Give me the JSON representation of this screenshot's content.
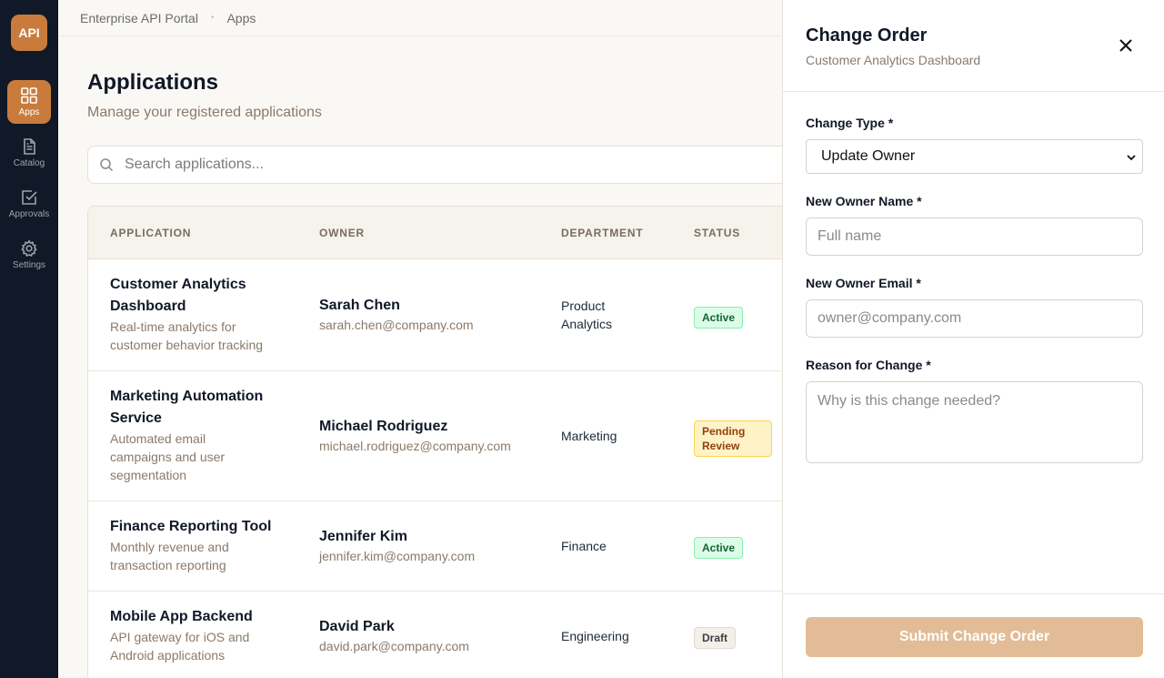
{
  "sidebar": {
    "logo": "API",
    "items": [
      {
        "label": "Apps",
        "icon": "grid-icon"
      },
      {
        "label": "Catalog",
        "icon": "document-icon"
      },
      {
        "label": "Approvals",
        "icon": "checkbox-icon"
      },
      {
        "label": "Settings",
        "icon": "gear-icon"
      }
    ]
  },
  "breadcrumb": {
    "root": "Enterprise API Portal",
    "sep": "•",
    "current": "Apps"
  },
  "page": {
    "title": "Applications",
    "subtitle": "Manage your registered applications"
  },
  "search": {
    "placeholder": "Search applications..."
  },
  "table": {
    "columns": [
      "APPLICATION",
      "OWNER",
      "DEPARTMENT",
      "STATUS"
    ],
    "rows": [
      {
        "name_l1": "Customer Analytics",
        "name_l2": "Dashboard",
        "desc_l1": "Real-time analytics for",
        "desc_l2": "customer behavior tracking",
        "desc_l3": "",
        "owner": "Sarah Chen",
        "email": "sarah.chen@company.com",
        "dept_l1": "Product",
        "dept_l2": "Analytics",
        "status_l1": "Active",
        "status_l2": ""
      },
      {
        "name_l1": "Marketing Automation",
        "name_l2": "Service",
        "desc_l1": "Automated email",
        "desc_l2": "campaigns and user",
        "desc_l3": "segmentation",
        "owner": "Michael Rodriguez",
        "email": "michael.rodriguez@company.com",
        "dept_l1": "Marketing",
        "dept_l2": "",
        "status_l1": "Pending",
        "status_l2": "Review"
      },
      {
        "name_l1": "Finance Reporting Tool",
        "name_l2": "",
        "desc_l1": "Monthly revenue and",
        "desc_l2": "transaction reporting",
        "desc_l3": "",
        "owner": "Jennifer Kim",
        "email": "jennifer.kim@company.com",
        "dept_l1": "Finance",
        "dept_l2": "",
        "status_l1": "Active",
        "status_l2": ""
      },
      {
        "name_l1": "Mobile App Backend",
        "name_l2": "",
        "desc_l1": "API gateway for iOS and",
        "desc_l2": "Android applications",
        "desc_l3": "",
        "owner": "David Park",
        "email": "david.park@company.com",
        "dept_l1": "Engineering",
        "dept_l2": "",
        "status_l1": "Draft",
        "status_l2": ""
      }
    ]
  },
  "drawer": {
    "title": "Change Order",
    "subtitle": "Customer Analytics Dashboard",
    "change_type_label": "Change Type *",
    "change_type_value": "Update Owner",
    "owner_name_label": "New Owner Name *",
    "owner_name_placeholder": "Full name",
    "owner_email_label": "New Owner Email *",
    "owner_email_placeholder": "owner@company.com",
    "reason_label": "Reason for Change *",
    "reason_placeholder": "Why is this change needed?",
    "submit_label": "Submit Change Order"
  },
  "colors": {
    "accent": "#c97b3c",
    "sidebar_bg": "#111827",
    "submit_disabled": "#e2bc96"
  }
}
